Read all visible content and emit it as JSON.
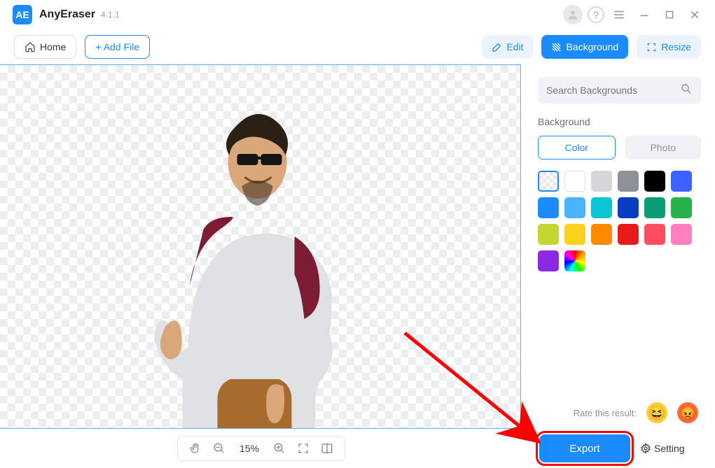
{
  "app": {
    "name": "AnyEraser",
    "version": "4.1.1"
  },
  "toolbar": {
    "home_label": "Home",
    "add_file_label": "+ Add File",
    "edit_label": "Edit",
    "background_label": "Background",
    "resize_label": "Resize"
  },
  "sidebar": {
    "search_placeholder": "Search Backgrounds",
    "section_label": "Background",
    "tabs": {
      "color": "Color",
      "photo": "Photo"
    },
    "swatches": [
      {
        "kind": "transparent",
        "name": "transparent"
      },
      {
        "kind": "white",
        "name": "white"
      },
      {
        "color": "#d4d6d9",
        "name": "light-gray"
      },
      {
        "color": "#8e9297",
        "name": "gray"
      },
      {
        "color": "#000000",
        "name": "black"
      },
      {
        "color": "#3a63ff",
        "name": "blue-600"
      },
      {
        "color": "#1b8cff",
        "name": "blue-500"
      },
      {
        "color": "#49b4ff",
        "name": "sky"
      },
      {
        "color": "#0bc4d6",
        "name": "teal"
      },
      {
        "color": "#0a3ec2",
        "name": "navy"
      },
      {
        "color": "#0a9e77",
        "name": "emerald"
      },
      {
        "color": "#27b34a",
        "name": "green"
      },
      {
        "color": "#c5d633",
        "name": "lime"
      },
      {
        "color": "#ffd21f",
        "name": "yellow"
      },
      {
        "color": "#ff8a00",
        "name": "orange"
      },
      {
        "color": "#e81b1b",
        "name": "red"
      },
      {
        "color": "#ff4e62",
        "name": "coral"
      },
      {
        "color": "#ff7fbf",
        "name": "pink"
      },
      {
        "color": "#8a2be2",
        "name": "purple"
      },
      {
        "kind": "rainbow",
        "name": "custom-color"
      }
    ]
  },
  "zoom": {
    "percent": "15%"
  },
  "rate": {
    "label": "Rate this result:"
  },
  "export": {
    "label": "Export",
    "setting_label": "Setting"
  }
}
